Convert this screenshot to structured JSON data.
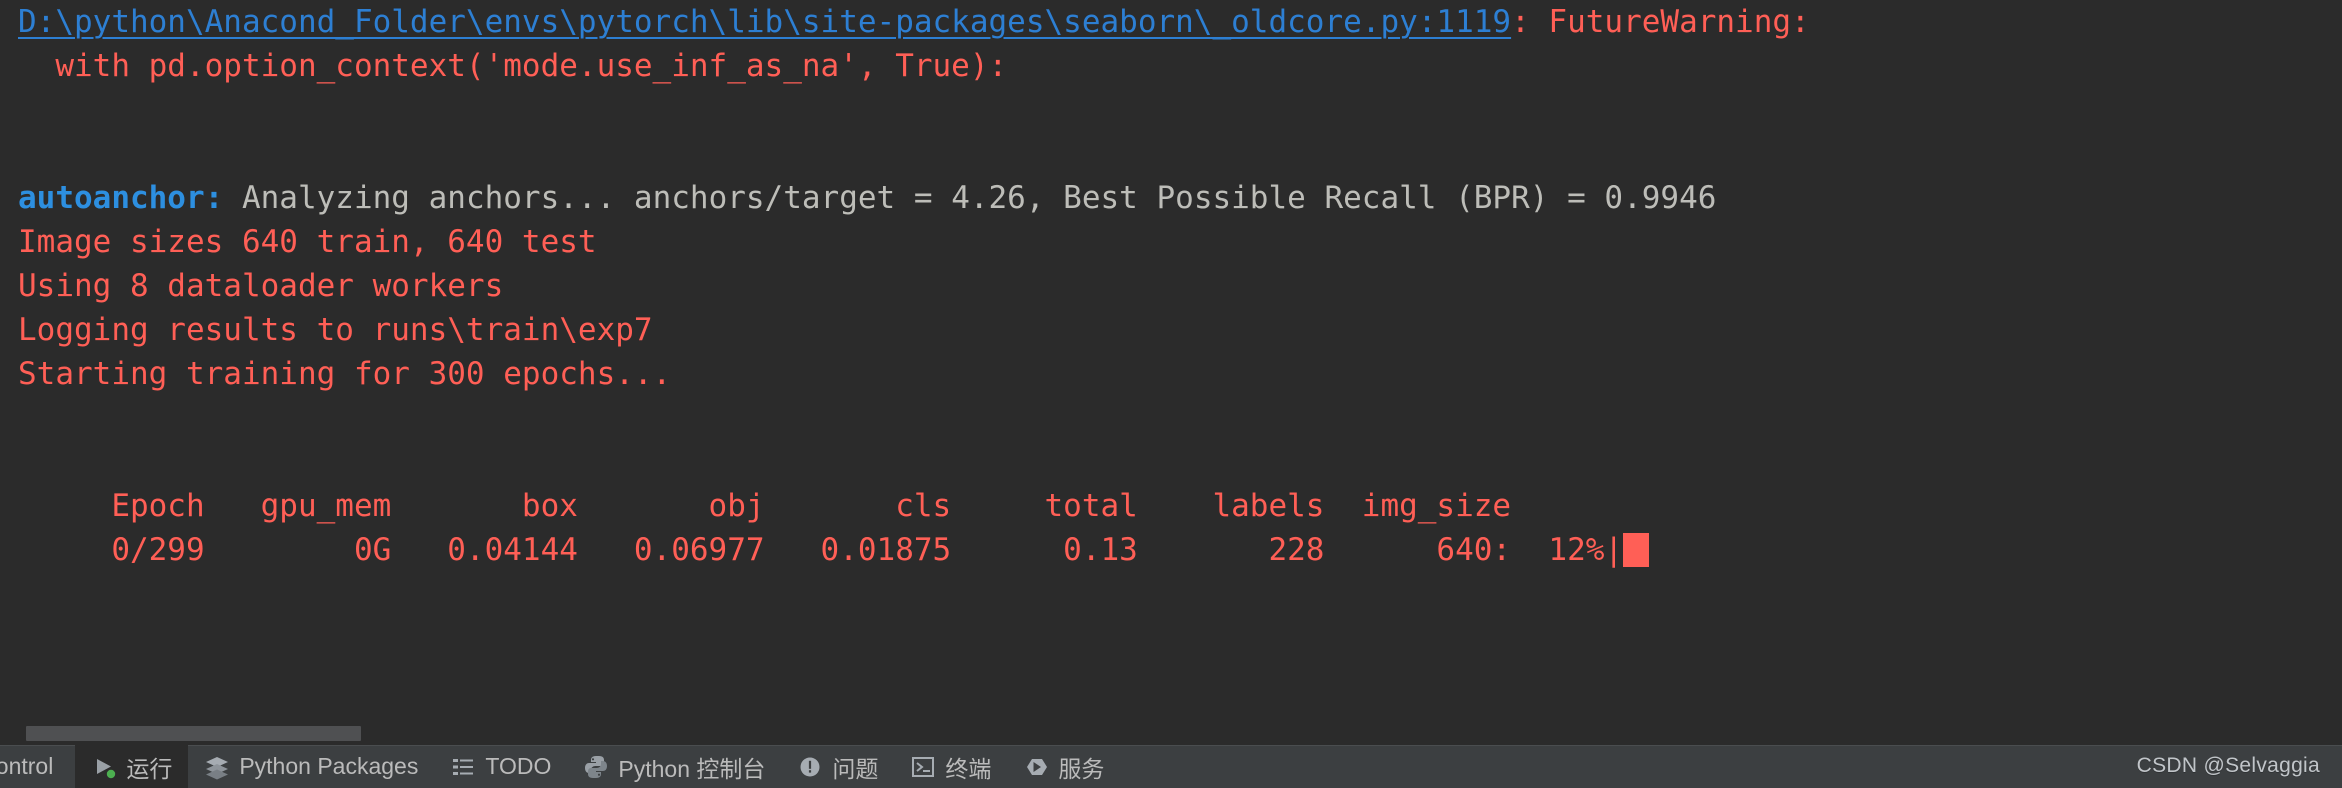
{
  "window": {
    "background": "#2b2b2b",
    "accent_red": "#ff5f56",
    "accent_blue": "#2d7fd3",
    "accent_gray": "#bdbdb8"
  },
  "console": {
    "warning_link": "D:\\python\\Anacond_Folder\\envs\\pytorch\\lib\\site-packages\\seaborn\\_oldcore.py:1119",
    "warning_suffix": ": FutureWarning:",
    "warning_code": "  with pd.option_context('mode.use_inf_as_na', True):",
    "autoanchor_key": "autoanchor:",
    "autoanchor_text": " Analyzing anchors... anchors/target = 4.26, Best Possible Recall (BPR) = 0.9946",
    "image_sizes": "Image sizes 640 train, 640 test",
    "dataloader": "Using 8 dataloader workers",
    "logging": "Logging results to runs\\train\\exp7",
    "starting": "Starting training for 300 epochs..."
  },
  "table": {
    "headers": [
      "Epoch",
      "gpu_mem",
      "box",
      "obj",
      "cls",
      "total",
      "labels",
      "img_size"
    ],
    "header_line": "     Epoch   gpu_mem       box       obj       cls     total    labels  img_size",
    "row_line": "     0/299        0G   0.04144   0.06977   0.01875      0.13       228      640:  12%|",
    "row": {
      "epoch": "0/299",
      "gpu_mem": "0G",
      "box": "0.04144",
      "obj": "0.06977",
      "cls": "0.01875",
      "total": "0.13",
      "labels": "228",
      "img_size": "640:",
      "progress_percent": "12%",
      "progress_bar_prefix": "|"
    }
  },
  "statusbar": {
    "items": [
      {
        "label": "n Control",
        "icon": "version-control-icon",
        "selected": false,
        "icon_visible": false
      },
      {
        "label": "运行",
        "icon": "run-icon",
        "selected": true,
        "icon_visible": true
      },
      {
        "label": "Python Packages",
        "icon": "packages-icon",
        "selected": false,
        "icon_visible": true
      },
      {
        "label": "TODO",
        "icon": "todo-list-icon",
        "selected": false,
        "icon_visible": true
      },
      {
        "label": "Python 控制台",
        "icon": "python-icon",
        "selected": false,
        "icon_visible": true
      },
      {
        "label": "问题",
        "icon": "problems-icon",
        "selected": false,
        "icon_visible": true
      },
      {
        "label": "终端",
        "icon": "terminal-icon",
        "selected": false,
        "icon_visible": true
      },
      {
        "label": "服务",
        "icon": "services-icon",
        "selected": false,
        "icon_visible": true
      }
    ]
  },
  "watermark": {
    "text": "CSDN @Selvaggia"
  }
}
